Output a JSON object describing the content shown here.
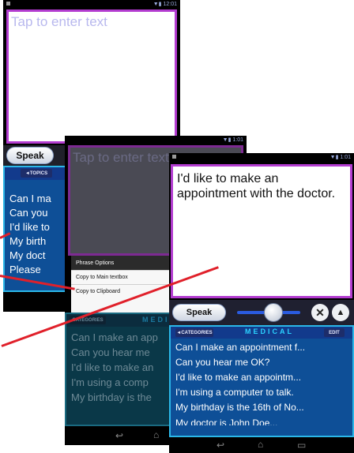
{
  "screen1": {
    "textbox_placeholder": "Tap to enter text",
    "speak_label": "Speak",
    "topics_label": "◄TOPICS",
    "phrases": [
      "Can I ma",
      "Can you",
      "I'd like to",
      "My birth",
      "My doct",
      "Please"
    ]
  },
  "screen2": {
    "textbox_placeholder": "Tap to enter text",
    "popup": {
      "title": "Phrase Options",
      "items": [
        "Copy to Main textbox",
        "Copy to Clipboard"
      ]
    },
    "category_title": "MEDICAL",
    "categories_label": "CATEGORIES",
    "phrases": [
      "Can I make an app",
      "Can you hear me",
      "I'd like to make an",
      "I'm using a comp",
      "My birthday is the"
    ]
  },
  "screen3": {
    "textbox_text": "I'd like to make an appointment with the doctor.",
    "speak_label": "Speak",
    "close_glyph": "✕",
    "up_glyph": "▲",
    "categories_label": "◄CATEGORIES",
    "category_title": "MEDICAL",
    "edit_label": "EDIT",
    "phrases": [
      "Can I make an appointment f...",
      "Can you hear me OK?",
      "I'd like to make an appointm...",
      "I'm using a computer to talk.",
      "My birthday is the 16th of No...",
      "My doctor is John Doe..."
    ]
  },
  "colors": {
    "textbox_border": "#b33cd0",
    "panel_bg": "#0e4f97",
    "panel_border": "#2bb7e8",
    "accent_title": "#2bd2ff",
    "arrow_red": "#e0202a"
  },
  "icons": {
    "nav_back": "↩",
    "nav_home": "⌂",
    "nav_recent": "▭"
  }
}
